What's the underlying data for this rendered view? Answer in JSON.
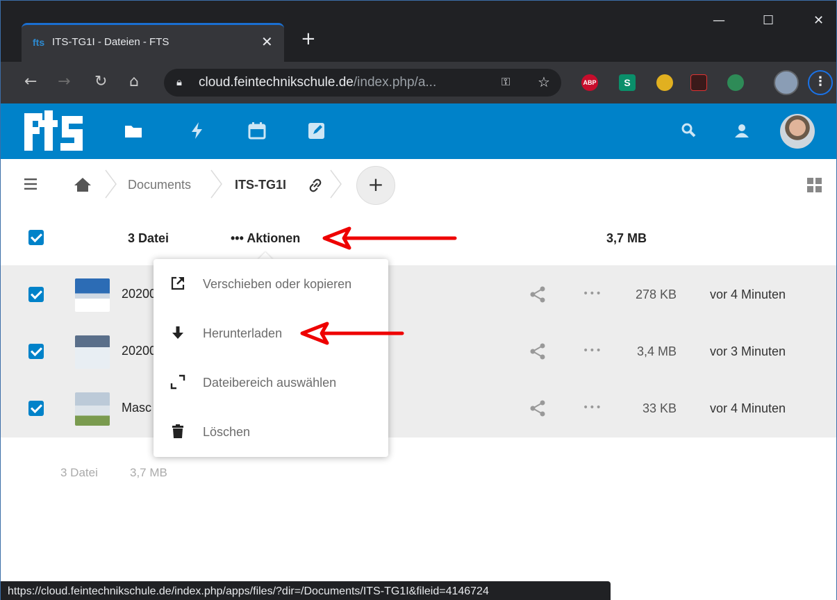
{
  "browser": {
    "tab_favicon": "fts",
    "tab_title": "ITS-TG1I - Dateien - FTS",
    "tab_close": "✕",
    "new_tab": "+",
    "url_host": "cloud.feintechnikschule.de",
    "url_path": "/index.php/a...",
    "status_url": "https://cloud.feintechnikschule.de/index.php/apps/files/?dir=/Documents/ITS-TG1I&fileid=4146724",
    "extensions": [
      "ABP",
      "S",
      "",
      "",
      ""
    ]
  },
  "app": {
    "logo_text": "fts",
    "accent": "#0082c9",
    "apps": [
      "files-icon",
      "activity-icon",
      "calendar-icon",
      "notes-icon"
    ]
  },
  "breadcrumb": {
    "items": [
      "Documents",
      "ITS-TG1I"
    ],
    "add_label": "+"
  },
  "header": {
    "count": "3 Datei",
    "actions": "••• Aktionen",
    "size": "3,7 MB"
  },
  "files": [
    {
      "name": "20200",
      "size": "278 KB",
      "modified": "vor 4 Minuten"
    },
    {
      "name": "20200",
      "size": "3,4 MB",
      "modified": "vor 3 Minuten"
    },
    {
      "name": "Masc",
      "size": "33 KB",
      "modified": "vor 4 Minuten"
    }
  ],
  "more_glyph": "•••",
  "menu": [
    {
      "label": "Verschieben oder kopieren",
      "icon": "external-icon"
    },
    {
      "label": "Herunterladen",
      "icon": "download-icon"
    },
    {
      "label": "Dateibereich auswählen",
      "icon": "select-range-icon"
    },
    {
      "label": "Löschen",
      "icon": "trash-icon"
    }
  ],
  "summary": {
    "count": "3 Datei",
    "size": "3,7 MB"
  }
}
